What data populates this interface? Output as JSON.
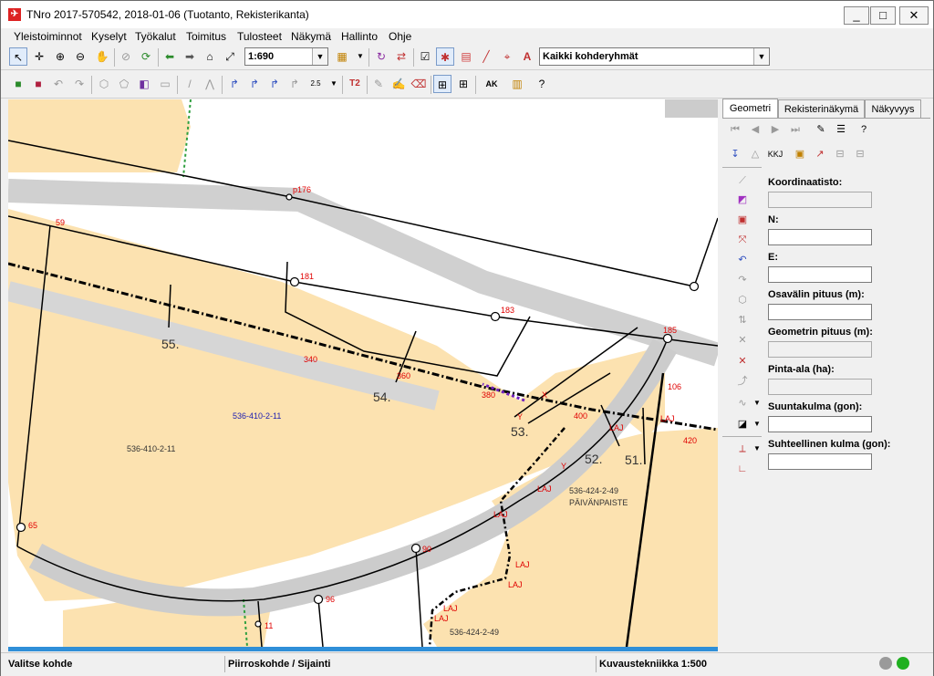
{
  "window": {
    "title": "TNro 2017-570542, 2018-01-06 (Tuotanto, Rekisterikanta)",
    "minimize": "_",
    "maximize": "□",
    "close": "✕"
  },
  "menu": [
    "Yleistoiminnot",
    "Kyselyt",
    "Työkalut",
    "Toimitus",
    "Tulosteet",
    "Näkymä",
    "Hallinto",
    "Ohje"
  ],
  "toolbar": {
    "scale": "1:690",
    "layer_group": "Kaikki kohderyhmät",
    "text_tool": "T2",
    "ak_button": "AK",
    "dim_label": "2.5"
  },
  "panel": {
    "tabs": [
      "Geometri",
      "Rekisterinäkymä",
      "Näkyvyys"
    ],
    "kkj": "KKJ",
    "fields": {
      "coord": "Koordinaatisto:",
      "n": "N:",
      "e": "E:",
      "segment_length": "Osavälin pituus (m):",
      "geometry_length": "Geometrin pituus (m):",
      "area": "Pinta-ala (ha):",
      "direction": "Suuntakulma (gon):",
      "relative_angle": "Suhteellinen kulma (gon):"
    }
  },
  "map": {
    "points": [
      "p176",
      "59",
      "181",
      "183",
      "185",
      "340",
      "360",
      "380",
      "400",
      "106",
      "420",
      "65",
      "90",
      "96",
      "11"
    ],
    "parcels": [
      "55.",
      "54.",
      "53.",
      "52.",
      "51."
    ],
    "ids": [
      "536-410-2-11",
      "536-410-2-11",
      "536-424-2-49",
      "536-424-2-49"
    ],
    "place_name": "PÄIVÄNPAISTE",
    "tags": [
      "LAJ",
      "Y",
      "X"
    ]
  },
  "status": {
    "left": "Valitse kohde",
    "middle": "Piirroskohde / Sijainti",
    "right": "Kuvaustekniikka 1:500"
  },
  "colors": {
    "parcel_fill": "#fce2b0",
    "road_gray": "#c8c8c8",
    "label_red": "#e00000",
    "id_blue": "#2020b0",
    "status_blue": "#2f8fd8"
  }
}
